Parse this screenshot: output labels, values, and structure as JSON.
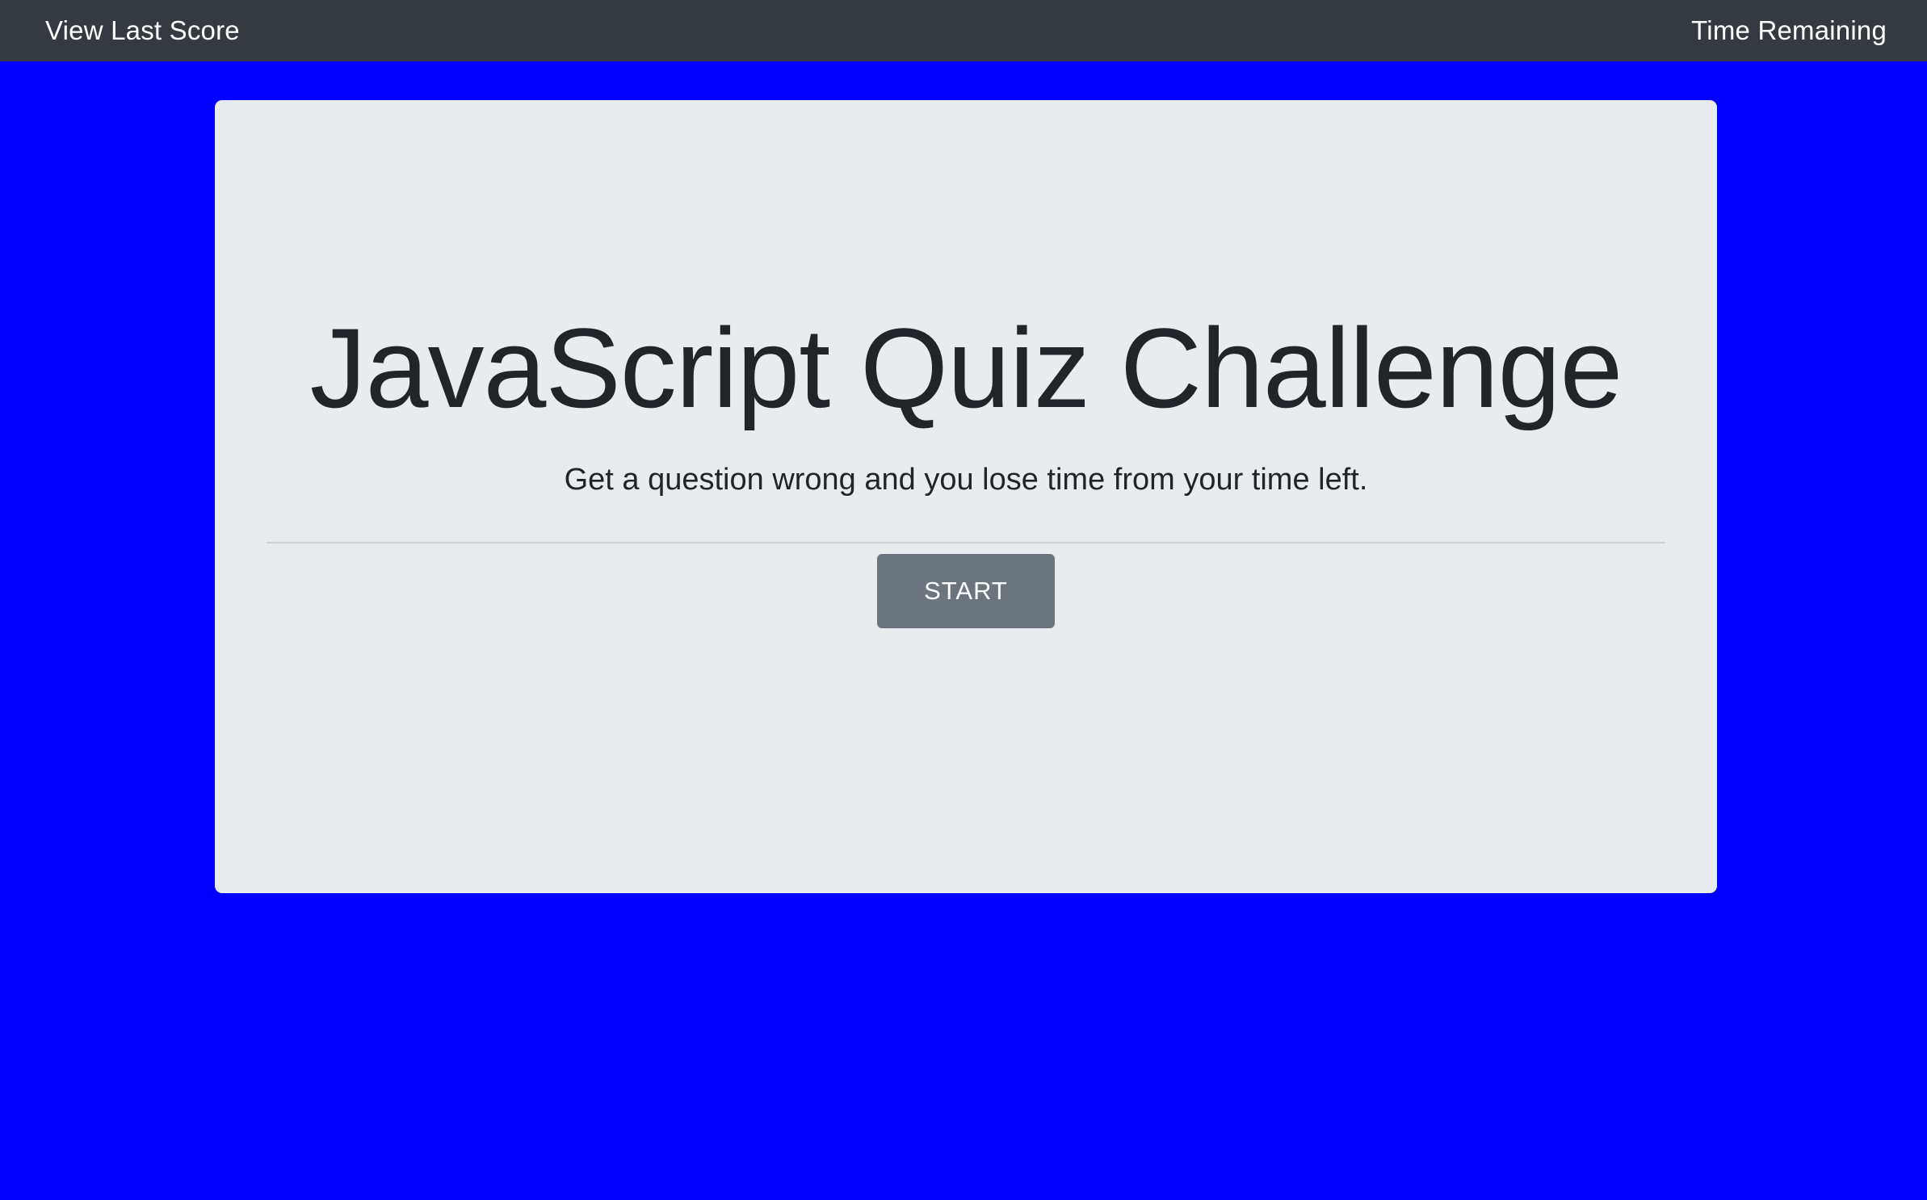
{
  "navbar": {
    "left_link": "View Last Score",
    "right_text": "Time Remaining"
  },
  "jumbotron": {
    "title": "JavaScript Quiz Challenge",
    "subtitle": "Get a question wrong and you lose time from your time left.",
    "start_label": "START"
  },
  "colors": {
    "page_background": "#0000ff",
    "navbar_background": "#343a40",
    "card_background": "#e9ecef",
    "button_background": "#6c757d",
    "text_dark": "#212529",
    "text_light": "#ffffff"
  }
}
